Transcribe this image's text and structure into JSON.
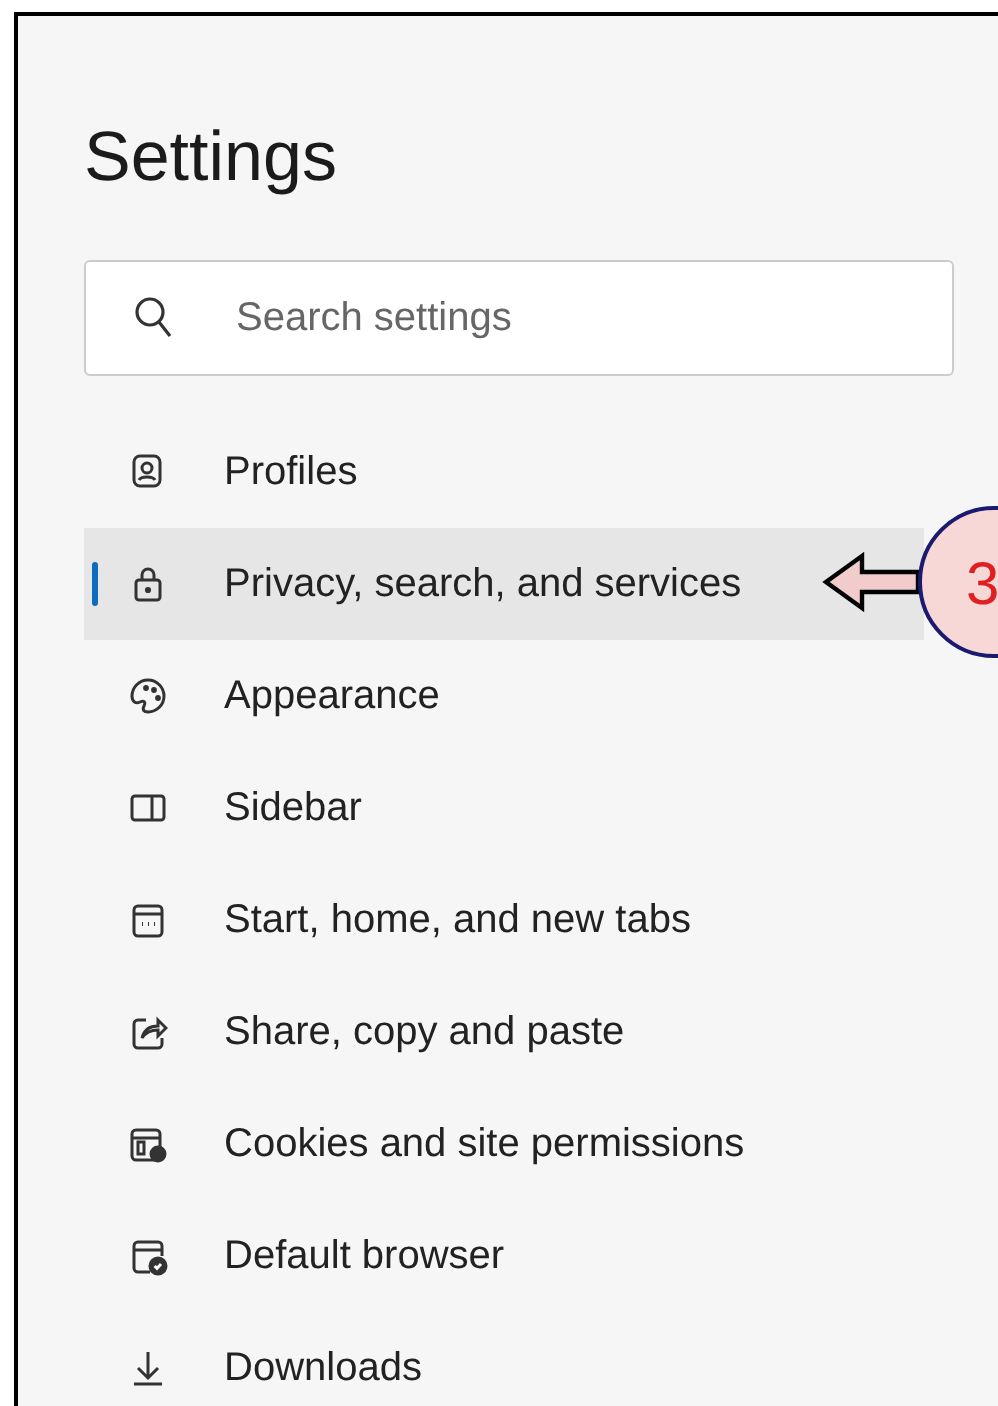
{
  "title": "Settings",
  "search": {
    "placeholder": "Search settings"
  },
  "nav": [
    {
      "label": "Profiles",
      "selected": false
    },
    {
      "label": "Privacy, search, and services",
      "selected": true
    },
    {
      "label": "Appearance",
      "selected": false
    },
    {
      "label": "Sidebar",
      "selected": false
    },
    {
      "label": "Start, home, and new tabs",
      "selected": false
    },
    {
      "label": "Share, copy and paste",
      "selected": false
    },
    {
      "label": "Cookies and site permissions",
      "selected": false
    },
    {
      "label": "Default browser",
      "selected": false
    },
    {
      "label": "Downloads",
      "selected": false
    }
  ],
  "callout": {
    "text": "3"
  }
}
